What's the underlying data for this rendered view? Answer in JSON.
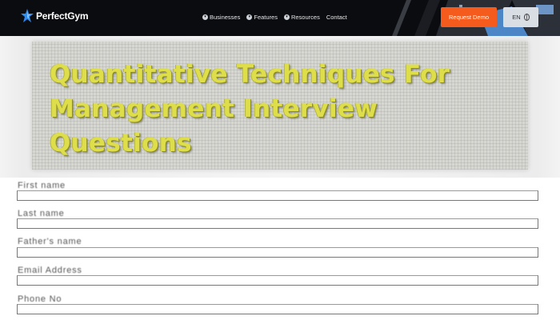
{
  "header": {
    "brand": "PerfectGym",
    "nav": [
      {
        "label": "Businesses",
        "icon": "chevron-down-icon"
      },
      {
        "label": "Features",
        "icon": "chevron-down-icon"
      },
      {
        "label": "Resources",
        "icon": "chevron-down-icon"
      },
      {
        "label": "Contact"
      }
    ],
    "cta": "Request Demo",
    "language": "EN",
    "colors": {
      "bar": "#0b0c10",
      "cta": "#f45b1c",
      "lang": "#d9dde4"
    }
  },
  "hero": {
    "line1": "Quantitative Techniques For",
    "line2": "Management Interview",
    "line3": "Questions",
    "text_color": "#dede4a"
  },
  "form": {
    "fields": [
      {
        "label": "First name",
        "value": ""
      },
      {
        "label": "Last name",
        "value": ""
      },
      {
        "label": "Father's name",
        "value": ""
      },
      {
        "label": "Email Address",
        "value": ""
      },
      {
        "label": "Phone No",
        "value": ""
      }
    ]
  }
}
